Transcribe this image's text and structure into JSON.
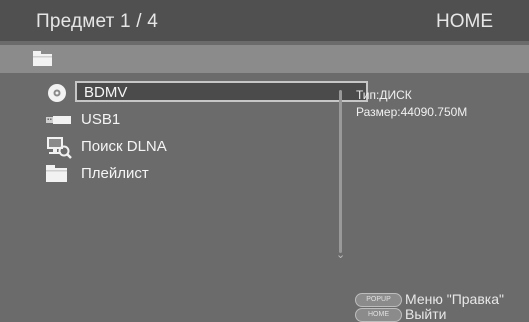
{
  "header": {
    "title": "Предмет 1 / 4",
    "home": "HOME"
  },
  "pathbar": {
    "icon": "folder-icon"
  },
  "items": [
    {
      "label": "BDMV",
      "icon": "disc-icon",
      "selected": true
    },
    {
      "label": "USB1",
      "icon": "usb-icon"
    },
    {
      "label": "Поиск DLNA",
      "icon": "dlna-search-icon"
    },
    {
      "label": "Плейлист",
      "icon": "folder-icon"
    }
  ],
  "info": {
    "type": "Тип:ДИСК",
    "size": "Размер:44090.750M"
  },
  "footer": {
    "popup_key": "POPUP",
    "popup_text": "Меню \"Правка\"",
    "home_key": "HOME",
    "home_text": "Выйти"
  },
  "colors": {
    "background": "#6b6b6b",
    "header": "#505050",
    "pathbar": "#8b8b8b"
  }
}
